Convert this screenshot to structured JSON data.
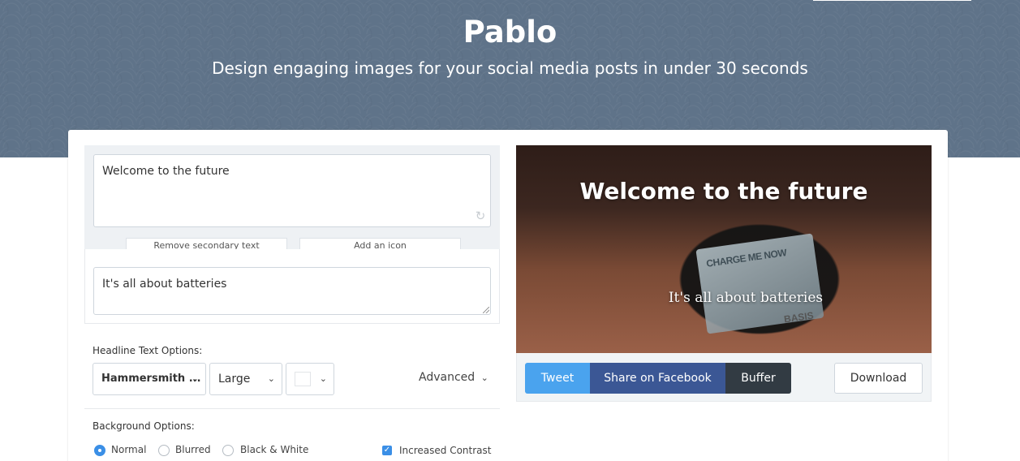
{
  "header": {
    "title": "Pablo",
    "subtitle": "Design engaging images for your social media posts in under 30 seconds"
  },
  "editor": {
    "headline_text": "Welcome to the future",
    "remove_secondary_label": "Remove secondary text",
    "add_icon_label": "Add an icon",
    "secondary_text": "It's all about batteries",
    "headline_options_label": "Headline Text Options:",
    "font_select": "Hammersmith ...",
    "size_select": "Large",
    "color_select": "#ffffff",
    "advanced_label": "Advanced",
    "background_options_label": "Background Options:",
    "background_options": [
      {
        "label": "Normal",
        "selected": true
      },
      {
        "label": "Blurred",
        "selected": false
      },
      {
        "label": "Black & White",
        "selected": false
      }
    ],
    "increased_contrast_label": "Increased Contrast",
    "increased_contrast_checked": true
  },
  "preview": {
    "headline": "Welcome to the future",
    "secondary": "It's all about batteries",
    "watch_screen_text": "CHARGE ME NOW",
    "watch_brand": "BASIS"
  },
  "share": {
    "tweet_label": "Tweet",
    "facebook_label": "Share on Facebook",
    "buffer_label": "Buffer",
    "download_label": "Download",
    "colors": {
      "tweet": "#4aa3ee",
      "facebook": "#3b5795",
      "buffer": "#323b43"
    }
  }
}
